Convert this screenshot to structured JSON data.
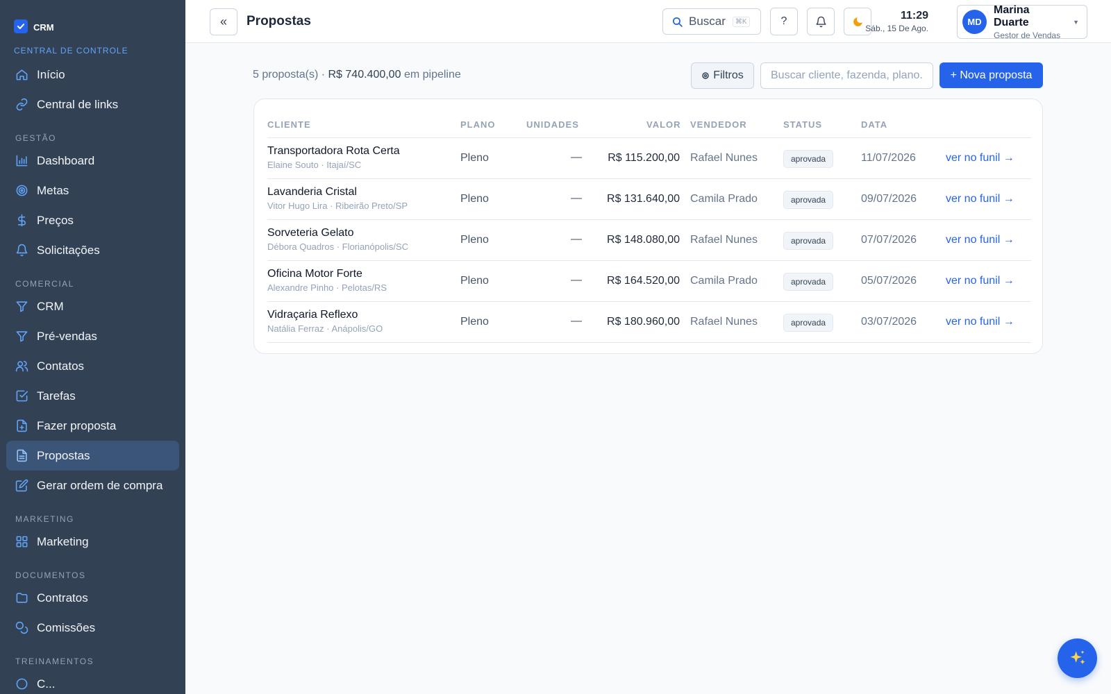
{
  "sidebar": {
    "brand": "CRM",
    "subtitle": "CENTRAL DE CONTROLE",
    "top_items": [
      {
        "label": "Início",
        "icon": "home-icon"
      },
      {
        "label": "Central de links",
        "icon": "link-icon"
      }
    ],
    "sections": [
      {
        "label": "GESTÃO",
        "items": [
          "Dashboard",
          "Metas",
          "Preços",
          "Solicitações"
        ]
      },
      {
        "label": "COMERCIAL",
        "items": [
          "CRM",
          "Pré-vendas",
          "Contatos",
          "Tarefas",
          "Fazer proposta",
          "Propostas",
          "Gerar ordem de compra"
        ]
      },
      {
        "label": "MARKETING",
        "items": [
          "Marketing"
        ]
      },
      {
        "label": "DOCUMENTOS",
        "items": [
          "Contratos",
          "Comissões"
        ]
      },
      {
        "label": "TREINAMENTOS",
        "items": [
          "C..."
        ]
      }
    ],
    "active_item": "Propostas"
  },
  "topbar": {
    "collapse_glyph": "«",
    "title": "Propostas",
    "search_label": "Buscar",
    "search_shortcut": "⌘K",
    "help_glyph": "?",
    "time": "11:29",
    "date": "Sáb., 15 De Ago.",
    "user": {
      "initials": "MD",
      "name": "Marina Duarte",
      "role": "Gestor de Vendas"
    }
  },
  "toolbar": {
    "summary_count": "5 proposta(s) ·",
    "summary_value": "R$ 740.400,00",
    "summary_suffix": "em pipeline",
    "filters_label": "Filtros",
    "search_placeholder": "Buscar cliente, fazenda, plano...",
    "new_label": "+ Nova proposta"
  },
  "table": {
    "headers": {
      "cliente": "CLIENTE",
      "plano": "PLANO",
      "unidades": "UNIDADES",
      "valor": "VALOR",
      "vendedor": "VENDEDOR",
      "status": "STATUS",
      "data": "DATA"
    },
    "rows": [
      {
        "name": "Transportadora Rota Certa",
        "sub": "Elaine Souto · Itajaí/SC",
        "plan": "Pleno",
        "units": "—",
        "value": "R$ 115.200,00",
        "seller": "Rafael Nunes",
        "status": "aprovada",
        "date": "11/07/2026",
        "link": "ver no funil →"
      },
      {
        "name": "Lavanderia Cristal",
        "sub": "Vitor Hugo Lira · Ribeirão Preto/SP",
        "plan": "Pleno",
        "units": "—",
        "value": "R$ 131.640,00",
        "seller": "Camila Prado",
        "status": "aprovada",
        "date": "09/07/2026",
        "link": "ver no funil →"
      },
      {
        "name": "Sorveteria Gelato",
        "sub": "Débora Quadros · Florianópolis/SC",
        "plan": "Pleno",
        "units": "—",
        "value": "R$ 148.080,00",
        "seller": "Rafael Nunes",
        "status": "aprovada",
        "date": "07/07/2026",
        "link": "ver no funil →"
      },
      {
        "name": "Oficina Motor Forte",
        "sub": "Alexandre Pinho · Pelotas/RS",
        "plan": "Pleno",
        "units": "—",
        "value": "R$ 164.520,00",
        "seller": "Camila Prado",
        "status": "aprovada",
        "date": "05/07/2026",
        "link": "ver no funil →"
      },
      {
        "name": "Vidraçaria Reflexo",
        "sub": "Natália Ferraz · Anápolis/GO",
        "plan": "Pleno",
        "units": "—",
        "value": "R$ 180.960,00",
        "seller": "Rafael Nunes",
        "status": "aprovada",
        "date": "03/07/2026",
        "link": "ver no funil →"
      }
    ]
  },
  "colors": {
    "sidebar_bg": "#334155",
    "accent": "#2563eb",
    "active_item_bg": "#3b5578"
  }
}
